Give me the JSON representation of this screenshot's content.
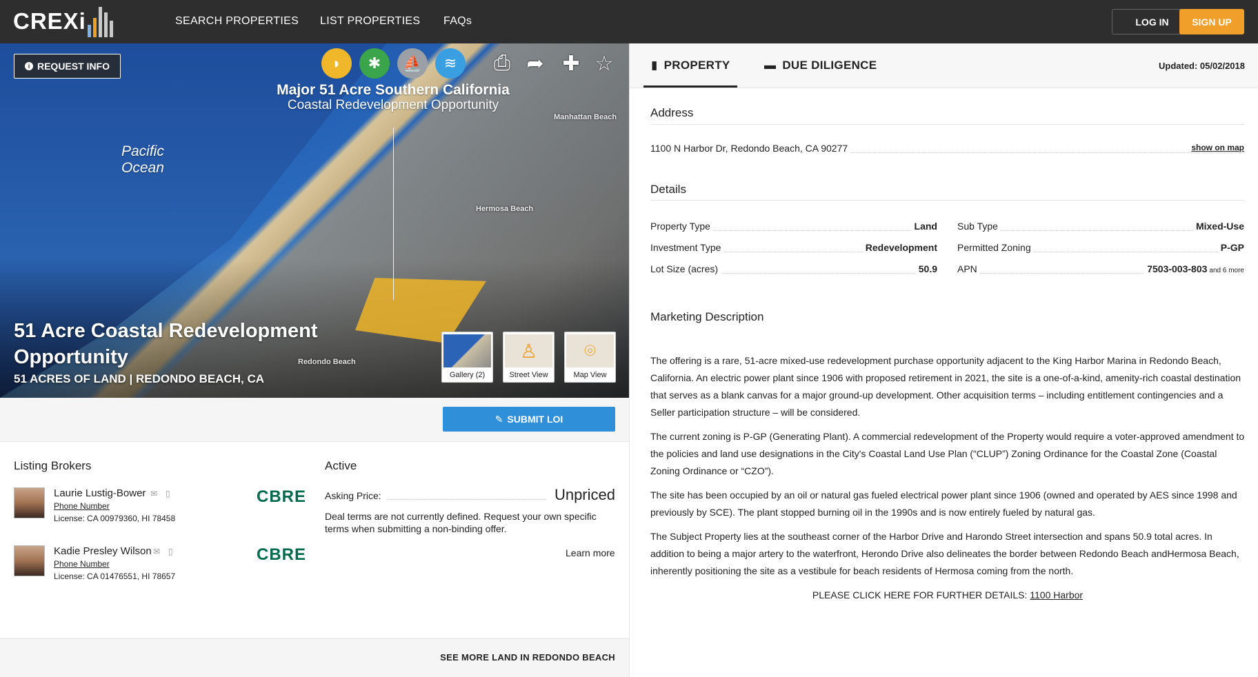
{
  "nav": {
    "logo_text": "CREXi",
    "links": [
      "SEARCH PROPERTIES",
      "LIST PROPERTIES",
      "FAQs"
    ],
    "login": "LOG IN",
    "signup": "SIGN UP"
  },
  "hero": {
    "request_info": "REQUEST INFO",
    "banner_line1": "Major 51 Acre Southern California",
    "banner_line2": "Coastal Redevelopment Opportunity",
    "map_labels": {
      "manhattan": "Manhattan Beach",
      "hermosa": "Hermosa Beach",
      "redondo": "Redondo Beach"
    },
    "ocean_line1": "Pacific",
    "ocean_line2": "Ocean",
    "title": "51 Acre Coastal Redevelopment Opportunity",
    "subtitle": "51 ACRES OF LAND | REDONDO BEACH, CA",
    "thumbs": [
      "Gallery (2)",
      "Street View",
      "Map View"
    ]
  },
  "submit_loi": "SUBMIT LOI",
  "brokers": {
    "heading": "Listing Brokers",
    "items": [
      {
        "name": "Laurie Lustig-Bower",
        "phone": "Phone Number",
        "license": "License: CA 00979360, HI 78458",
        "company": "CBRE"
      },
      {
        "name": "Kadie Presley Wilson",
        "phone": "Phone Number",
        "license": "License: CA 01476551, HI 78657",
        "company": "CBRE"
      }
    ]
  },
  "status": {
    "heading": "Active",
    "asking_label": "Asking Price:",
    "asking_value": "Unpriced",
    "deal_text": "Deal terms are not currently defined. Request your own specific terms when submitting a non-binding offer.",
    "learn_more": "Learn more"
  },
  "see_more": "SEE MORE LAND IN REDONDO BEACH",
  "tabs": {
    "property": "PROPERTY",
    "due_diligence": "DUE DILIGENCE",
    "updated": "Updated: 05/02/2018"
  },
  "address": {
    "heading": "Address",
    "value": "1100 N Harbor Dr, Redondo Beach, CA 90277",
    "show_map": "show on map"
  },
  "details": {
    "heading": "Details",
    "left": [
      {
        "k": "Property Type",
        "v": "Land"
      },
      {
        "k": "Investment Type",
        "v": "Redevelopment"
      },
      {
        "k": "Lot Size (acres)",
        "v": "50.9"
      }
    ],
    "right": [
      {
        "k": "Sub Type",
        "v": "Mixed-Use"
      },
      {
        "k": "Permitted Zoning",
        "v": "P-GP"
      },
      {
        "k": "APN",
        "v": "7503-003-803",
        "extra": "and 6 more"
      }
    ]
  },
  "marketing": {
    "heading": "Marketing Description",
    "paragraphs": [
      "The offering is a rare, 51-acre mixed-use redevelopment purchase opportunity adjacent to the King Harbor Marina in Redondo Beach, California. An electric power plant since 1906 with proposed retirement in 2021, the site is a one-of-a-kind, amenity-rich coastal destination that serves as a blank canvas for a major ground-up development. Other acquisition terms – including entitlement contingencies and a Seller participation structure – will be considered.",
      "The current zoning is P-GP (Generating Plant). A commercial redevelopment of the Property would require a voter-approved amendment to the policies and land use designations in the City's Coastal Land Use Plan (“CLUP”) Zoning Ordinance for the Coastal Zone (Coastal Zoning Ordinance or “CZO”).",
      "The site has been occupied by an oil or natural gas fueled electrical power plant since 1906 (owned and operated by AES since 1998 and previously by SCE). The plant stopped burning oil in the 1990s and is now entirely fueled by natural gas.",
      "The Subject Property lies at the southeast corner of the Harbor Drive and Harondo Street intersection and spans 50.9 total acres. In addition to being a major artery to the waterfront, Herondo Drive also delineates the border between Redondo Beach andHermosa Beach, inherently positioning the site as a vestibule for beach residents of Hermosa coming from the north."
    ],
    "further_label": "PLEASE CLICK HERE FOR FURTHER DETAILS:",
    "further_link": "1100 Harbor"
  },
  "colors": {
    "accent": "#f0a02a",
    "loi": "#2f8fd8",
    "cbre": "#006a4d",
    "nav": "#2e2e2e"
  }
}
